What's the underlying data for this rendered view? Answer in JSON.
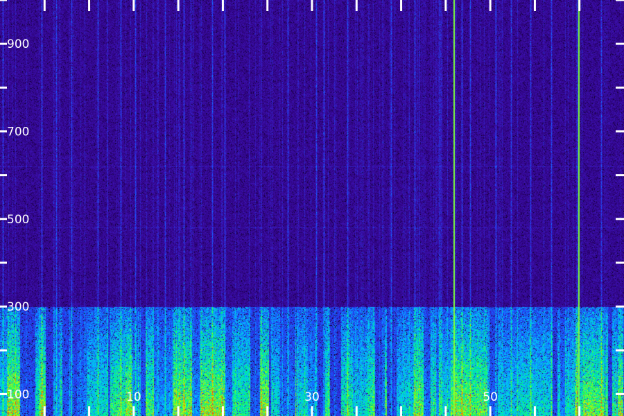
{
  "chart_data": {
    "type": "heatmap",
    "title": "",
    "xlabel": "",
    "ylabel": "",
    "xlim": [
      -5,
      65
    ],
    "ylim": [
      50,
      1000
    ],
    "x_tick_labels": [
      "10",
      "30",
      "50"
    ],
    "x_tick_values": [
      10,
      30,
      50
    ],
    "y_tick_labels": [
      "100",
      "300",
      "500",
      "700",
      "900"
    ],
    "y_tick_values": [
      100,
      300,
      500,
      700,
      900
    ],
    "grid": false,
    "colormap": [
      "#000000",
      "#2a006e",
      "#3c10b0",
      "#1b4fff",
      "#00c8ff",
      "#00ff6a",
      "#c8ff00",
      "#ff3a00"
    ],
    "intensity_bands": [
      {
        "y_from": 50,
        "y_to": 300,
        "level": "high"
      },
      {
        "y_from": 300,
        "y_to": 1000,
        "level": "low"
      }
    ],
    "vertical_streaks_x": [
      -4.7,
      -0.3,
      1.3,
      3.0,
      6.0,
      8.5,
      10.2,
      13.5,
      15.6,
      18.8,
      20.2,
      27.3,
      30.5,
      31.3,
      34.0,
      38.9,
      41.5,
      44.3,
      46.8,
      47.7,
      50.6,
      52.3,
      54.5,
      56.8,
      59.7,
      62.4
    ],
    "bright_lines_x": [
      45.9,
      59.9
    ],
    "horizontal_line_y": [
      620,
      480
    ]
  }
}
